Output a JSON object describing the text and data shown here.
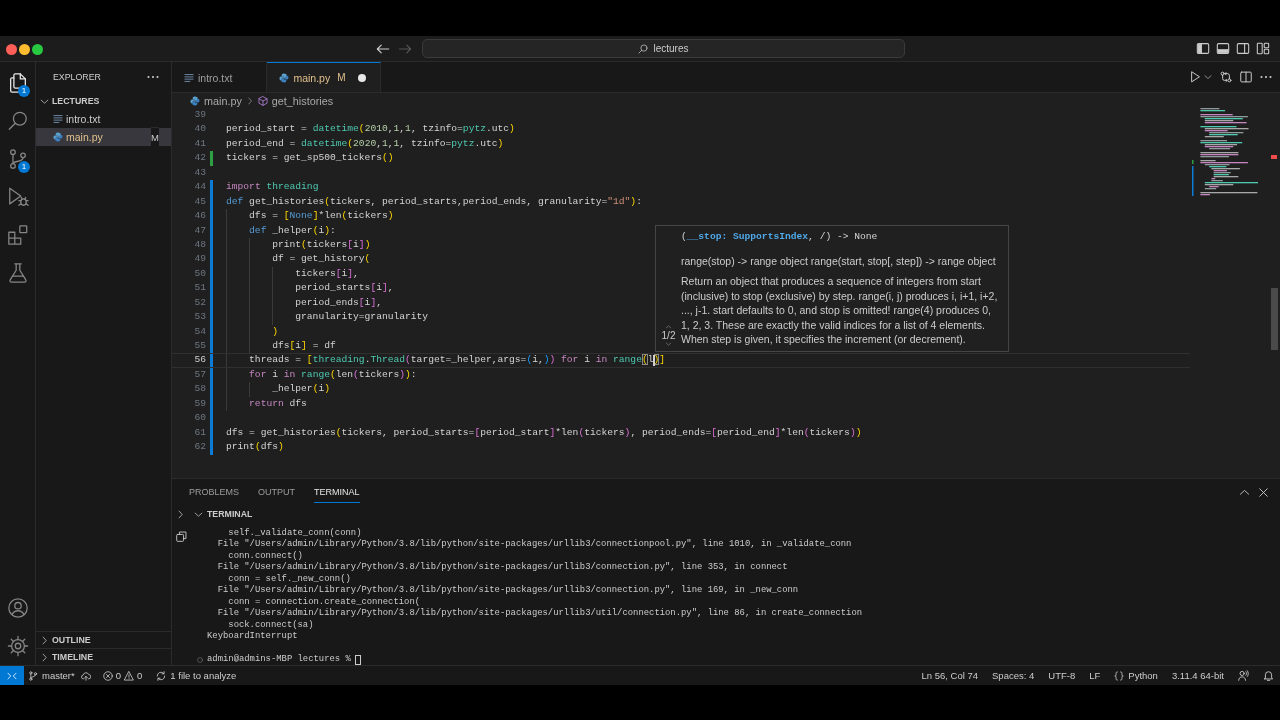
{
  "title_bar": {
    "nav": [
      {
        "kind": "back",
        "disabled": false
      },
      {
        "kind": "forward",
        "disabled": true
      }
    ],
    "search": "lectures",
    "layout_toggles": [
      {
        "kind": "primary-sidebar",
        "on": true
      },
      {
        "kind": "panel",
        "on": true
      },
      {
        "kind": "secondary-sidebar",
        "on": false
      },
      {
        "kind": "customize"
      }
    ]
  },
  "activity_bar": {
    "items": [
      {
        "kind": "explorer",
        "selected": true,
        "badge": "1"
      },
      {
        "kind": "search",
        "selected": false
      },
      {
        "kind": "source-control",
        "selected": false,
        "badge": "1"
      },
      {
        "kind": "run-debug",
        "selected": false
      },
      {
        "kind": "extensions",
        "selected": false
      },
      {
        "kind": "testing",
        "selected": false
      }
    ],
    "bottom": [
      {
        "kind": "account"
      },
      {
        "kind": "manage"
      }
    ]
  },
  "sidebar": {
    "title": "EXPLORER",
    "folder": {
      "name": "LECTURES",
      "expanded": true,
      "files": [
        {
          "name": "intro.txt",
          "kind": "text",
          "selected": false
        },
        {
          "name": "main.py",
          "kind": "python",
          "selected": true,
          "status": "M"
        }
      ]
    },
    "sections": [
      {
        "title": "OUTLINE",
        "expanded": false
      },
      {
        "title": "TIMELINE",
        "expanded": false
      }
    ]
  },
  "tabs": [
    {
      "label": "intro.txt",
      "kind": "text",
      "selected": false
    },
    {
      "label": "main.py",
      "kind": "python",
      "selected": true,
      "status": "M",
      "dirty": true
    }
  ],
  "breadcrumb": [
    {
      "label": "main.py",
      "kind": "file"
    },
    {
      "label": "get_histories",
      "kind": "symbol"
    }
  ],
  "editor": {
    "lines": [
      {
        "number": "39",
        "current": false
      },
      {
        "number": "40",
        "current": false,
        "tokens": [
          {
            "text": "period_start = ",
            "kind": "plain"
          },
          {
            "text": "datetime",
            "kind": "type"
          },
          {
            "text": "(",
            "kind": "bracket1"
          },
          {
            "text": "2010",
            "kind": "number"
          },
          {
            "text": ",",
            "kind": "plain"
          },
          {
            "text": "1",
            "kind": "number"
          },
          {
            "text": ",",
            "kind": "plain"
          },
          {
            "text": "1",
            "kind": "number"
          },
          {
            "text": ", tzinfo=",
            "kind": "plain"
          },
          {
            "text": "pytz",
            "kind": "type"
          },
          {
            "text": ".utc",
            "kind": "plain"
          },
          {
            "text": ")",
            "kind": "bracket1"
          }
        ]
      },
      {
        "number": "41",
        "current": false,
        "tokens": [
          {
            "text": "period_end = ",
            "kind": "plain"
          },
          {
            "text": "datetime",
            "kind": "type"
          },
          {
            "text": "(",
            "kind": "bracket1"
          },
          {
            "text": "2020",
            "kind": "number"
          },
          {
            "text": ",",
            "kind": "plain"
          },
          {
            "text": "1",
            "kind": "number"
          },
          {
            "text": ",",
            "kind": "plain"
          },
          {
            "text": "1",
            "kind": "number"
          },
          {
            "text": ", tzinfo=",
            "kind": "plain"
          },
          {
            "text": "pytz",
            "kind": "type"
          },
          {
            "text": ".utc",
            "kind": "plain"
          },
          {
            "text": ")",
            "kind": "bracket1"
          }
        ]
      },
      {
        "number": "42",
        "current": false,
        "color": "#2ea043",
        "tokens": [
          {
            "text": "tickers = get_sp500_tickers",
            "kind": "plain"
          },
          {
            "text": "()",
            "kind": "bracket1"
          }
        ]
      },
      {
        "number": "43",
        "current": false
      },
      {
        "number": "44",
        "current": false,
        "color": "#0c7bd6",
        "tokens": [
          {
            "text": "import ",
            "kind": "control"
          },
          {
            "text": "threading",
            "kind": "type"
          }
        ]
      },
      {
        "number": "45",
        "current": false,
        "color": "#0c7bd6",
        "tokens": [
          {
            "text": "def",
            "kind": "keyword"
          },
          {
            "text": " get_histories",
            "kind": "plain"
          },
          {
            "text": "(",
            "kind": "bracket1"
          },
          {
            "text": "tickers, period_starts,period_ends, granularity=",
            "kind": "plain"
          },
          {
            "text": "\"1d\"",
            "kind": "string"
          },
          {
            "text": ")",
            "kind": "bracket1"
          },
          {
            "text": ":",
            "kind": "plain"
          }
        ]
      },
      {
        "number": "46",
        "current": false,
        "color": "#0c7bd6",
        "tokens": [
          {
            "text": "    dfs = ",
            "kind": "plain"
          },
          {
            "text": "[",
            "kind": "bracket1"
          },
          {
            "text": "None",
            "kind": "keyword"
          },
          {
            "text": "]",
            "kind": "bracket1"
          },
          {
            "text": "*len",
            "kind": "plain"
          },
          {
            "text": "(",
            "kind": "bracket1"
          },
          {
            "text": "tickers",
            "kind": "plain"
          },
          {
            "text": ")",
            "kind": "bracket1"
          }
        ]
      },
      {
        "number": "47",
        "current": false,
        "color": "#0c7bd6",
        "tokens": [
          {
            "text": "    def",
            "kind": "keyword"
          },
          {
            "text": " _helper",
            "kind": "plain"
          },
          {
            "text": "(",
            "kind": "bracket1"
          },
          {
            "text": "i",
            "kind": "plain"
          },
          {
            "text": ")",
            "kind": "bracket1"
          },
          {
            "text": ":",
            "kind": "plain"
          }
        ]
      },
      {
        "number": "48",
        "current": false,
        "color": "#0c7bd6",
        "tokens": [
          {
            "text": "        print",
            "kind": "plain"
          },
          {
            "text": "(",
            "kind": "bracket1"
          },
          {
            "text": "tickers",
            "kind": "plain"
          },
          {
            "text": "[",
            "kind": "bracket2"
          },
          {
            "text": "i",
            "kind": "plain"
          },
          {
            "text": "]",
            "kind": "bracket2"
          },
          {
            "text": ")",
            "kind": "bracket1"
          }
        ]
      },
      {
        "number": "49",
        "current": false,
        "color": "#0c7bd6",
        "tokens": [
          {
            "text": "        df = get_history",
            "kind": "plain"
          },
          {
            "text": "(",
            "kind": "bracket1"
          }
        ]
      },
      {
        "number": "50",
        "current": false,
        "color": "#0c7bd6",
        "tokens": [
          {
            "text": "            tickers",
            "kind": "plain"
          },
          {
            "text": "[",
            "kind": "bracket2"
          },
          {
            "text": "i",
            "kind": "plain"
          },
          {
            "text": "]",
            "kind": "bracket2"
          },
          {
            "text": ",",
            "kind": "plain"
          }
        ]
      },
      {
        "number": "51",
        "current": false,
        "color": "#0c7bd6",
        "tokens": [
          {
            "text": "            period_starts",
            "kind": "plain"
          },
          {
            "text": "[",
            "kind": "bracket2"
          },
          {
            "text": "i",
            "kind": "plain"
          },
          {
            "text": "]",
            "kind": "bracket2"
          },
          {
            "text": ",",
            "kind": "plain"
          }
        ]
      },
      {
        "number": "52",
        "current": false,
        "color": "#0c7bd6",
        "tokens": [
          {
            "text": "            period_ends",
            "kind": "plain"
          },
          {
            "text": "[",
            "kind": "bracket2"
          },
          {
            "text": "i",
            "kind": "plain"
          },
          {
            "text": "]",
            "kind": "bracket2"
          },
          {
            "text": ",",
            "kind": "plain"
          }
        ]
      },
      {
        "number": "53",
        "current": false,
        "color": "#0c7bd6",
        "tokens": [
          {
            "text": "            granularity=granularity",
            "kind": "plain"
          }
        ]
      },
      {
        "number": "54",
        "current": false,
        "color": "#0c7bd6",
        "tokens": [
          {
            "text": "        )",
            "kind": "bracket1"
          }
        ]
      },
      {
        "number": "55",
        "current": false,
        "color": "#0c7bd6",
        "tokens": [
          {
            "text": "        dfs",
            "kind": "plain"
          },
          {
            "text": "[",
            "kind": "bracket1"
          },
          {
            "text": "i",
            "kind": "plain"
          },
          {
            "text": "]",
            "kind": "bracket1"
          },
          {
            "text": " = df",
            "kind": "plain"
          }
        ]
      },
      {
        "number": "56",
        "current": true,
        "color": "#0c7bd6",
        "tokens": [
          {
            "text": "    threads = ",
            "kind": "plain"
          },
          {
            "text": "[",
            "kind": "bracket1"
          },
          {
            "text": "threading",
            "kind": "type"
          },
          {
            "text": ".",
            "kind": "plain"
          },
          {
            "text": "Thread",
            "kind": "type"
          },
          {
            "text": "(",
            "kind": "bracket2"
          },
          {
            "text": "target=_helper,args=",
            "kind": "plain"
          },
          {
            "text": "(",
            "kind": "bracket3"
          },
          {
            "text": "i,",
            "kind": "plain"
          },
          {
            "text": ")",
            "kind": "bracket3"
          },
          {
            "text": ")",
            "kind": "bracket2"
          },
          {
            "text": " for",
            "kind": "control"
          },
          {
            "text": " i ",
            "kind": "plain"
          },
          {
            "text": "in ",
            "kind": "control"
          },
          {
            "text": "range",
            "kind": "type"
          },
          {
            "text": "(",
            "kind": "match"
          },
          {
            "text": "l",
            "kind": "plain",
            "caret_after": true
          },
          {
            "text": ")",
            "kind": "match"
          },
          {
            "text": "]",
            "kind": "bracket1"
          }
        ]
      },
      {
        "number": "57",
        "current": false,
        "color": "#0c7bd6",
        "tokens": [
          {
            "text": "    for",
            "kind": "control"
          },
          {
            "text": " i ",
            "kind": "plain"
          },
          {
            "text": "in ",
            "kind": "control"
          },
          {
            "text": "range",
            "kind": "type"
          },
          {
            "text": "(",
            "kind": "bracket1"
          },
          {
            "text": "len",
            "kind": "plain"
          },
          {
            "text": "(",
            "kind": "bracket2"
          },
          {
            "text": "tickers",
            "kind": "plain"
          },
          {
            "text": ")",
            "kind": "bracket2"
          },
          {
            "text": ")",
            "kind": "bracket1"
          },
          {
            "text": ":",
            "kind": "plain"
          }
        ]
      },
      {
        "number": "58",
        "current": false,
        "color": "#0c7bd6",
        "tokens": [
          {
            "text": "        _helper",
            "kind": "plain"
          },
          {
            "text": "(",
            "kind": "bracket1"
          },
          {
            "text": "i",
            "kind": "plain"
          },
          {
            "text": ")",
            "kind": "bracket1"
          }
        ]
      },
      {
        "number": "59",
        "current": false,
        "color": "#0c7bd6",
        "tokens": [
          {
            "text": "    return",
            "kind": "control"
          },
          {
            "text": " dfs",
            "kind": "plain"
          }
        ]
      },
      {
        "number": "60",
        "current": false,
        "color": "#0c7bd6"
      },
      {
        "number": "61",
        "current": false,
        "color": "#0c7bd6",
        "tokens": [
          {
            "text": "dfs = get_histories",
            "kind": "plain"
          },
          {
            "text": "(",
            "kind": "bracket1"
          },
          {
            "text": "tickers, period_starts=",
            "kind": "plain"
          },
          {
            "text": "[",
            "kind": "bracket2"
          },
          {
            "text": "period_start",
            "kind": "plain"
          },
          {
            "text": "]",
            "kind": "bracket2"
          },
          {
            "text": "*len",
            "kind": "plain"
          },
          {
            "text": "(",
            "kind": "bracket2"
          },
          {
            "text": "tickers",
            "kind": "plain"
          },
          {
            "text": ")",
            "kind": "bracket2"
          },
          {
            "text": ", period_ends=",
            "kind": "plain"
          },
          {
            "text": "[",
            "kind": "bracket2"
          },
          {
            "text": "period_end",
            "kind": "plain"
          },
          {
            "text": "]",
            "kind": "bracket2"
          },
          {
            "text": "*len",
            "kind": "plain"
          },
          {
            "text": "(",
            "kind": "bracket2"
          },
          {
            "text": "tickers",
            "kind": "plain"
          },
          {
            "text": ")",
            "kind": "bracket2"
          },
          {
            "text": ")",
            "kind": "bracket1"
          }
        ]
      },
      {
        "number": "62",
        "current": false,
        "color": "#0c7bd6",
        "tokens": [
          {
            "text": "print",
            "kind": "plain"
          },
          {
            "text": "(",
            "kind": "bracket1"
          },
          {
            "text": "dfs",
            "kind": "plain"
          },
          {
            "text": ")",
            "kind": "bracket1"
          }
        ]
      }
    ]
  },
  "hover": {
    "signature": [
      {
        "text": "(",
        "kind": "plain"
      },
      {
        "text": "__stop: SupportsIndex",
        "kind": "param"
      },
      {
        "text": ", /) -> None",
        "kind": "plain"
      }
    ],
    "pager": "1/2",
    "summary": "range(stop) -> range object range(start, stop[, step]) -> range object",
    "description": "Return an object that produces a sequence of integers from start (inclusive) to stop (exclusive) by step. range(i, j) produces i, i+1, i+2, ..., j-1. start defaults to 0, and stop is omitted! range(4) produces 0, 1, 2, 3. These are exactly the valid indices for a list of 4 elements. When step is given, it specifies the increment (or decrement)."
  },
  "panel": {
    "tabs": [
      {
        "label": "PROBLEMS",
        "selected": false
      },
      {
        "label": "OUTPUT",
        "selected": false
      },
      {
        "label": "TERMINAL",
        "selected": true
      }
    ],
    "section": {
      "title": "TERMINAL",
      "expanded": true
    },
    "terminal": {
      "lines": [
        "    self._validate_conn(conn)",
        "  File \"/Users/admin/Library/Python/3.8/lib/python/site-packages/urllib3/connectionpool.py\", line 1010, in _validate_conn",
        "    conn.connect()",
        "  File \"/Users/admin/Library/Python/3.8/lib/python/site-packages/urllib3/connection.py\", line 353, in connect",
        "    conn = self._new_conn()",
        "  File \"/Users/admin/Library/Python/3.8/lib/python/site-packages/urllib3/connection.py\", line 169, in _new_conn",
        "    conn = connection.create_connection(",
        "  File \"/Users/admin/Library/Python/3.8/lib/python/site-packages/urllib3/util/connection.py\", line 86, in create_connection",
        "    sock.connect(sa)",
        "KeyboardInterrupt"
      ],
      "prompt": "admin@admins-MBP lectures %"
    }
  },
  "status_bar": {
    "left": [
      {
        "kind": "remote"
      },
      {
        "kind": "branch",
        "label": "master*"
      },
      {
        "kind": "publish"
      },
      {
        "kind": "problems",
        "errors": "0",
        "warnings": "0"
      },
      {
        "kind": "progress",
        "label": "1 file to analyze"
      }
    ],
    "right": [
      {
        "kind": "text",
        "label": "Ln 56, Col 74"
      },
      {
        "kind": "text",
        "label": "Spaces: 4"
      },
      {
        "kind": "text",
        "label": "UTF-8"
      },
      {
        "kind": "text",
        "label": "LF"
      },
      {
        "kind": "language",
        "label": "Python"
      },
      {
        "kind": "text",
        "label": "3.11.4 64-bit"
      },
      {
        "kind": "feedback"
      },
      {
        "kind": "notifications"
      }
    ]
  }
}
